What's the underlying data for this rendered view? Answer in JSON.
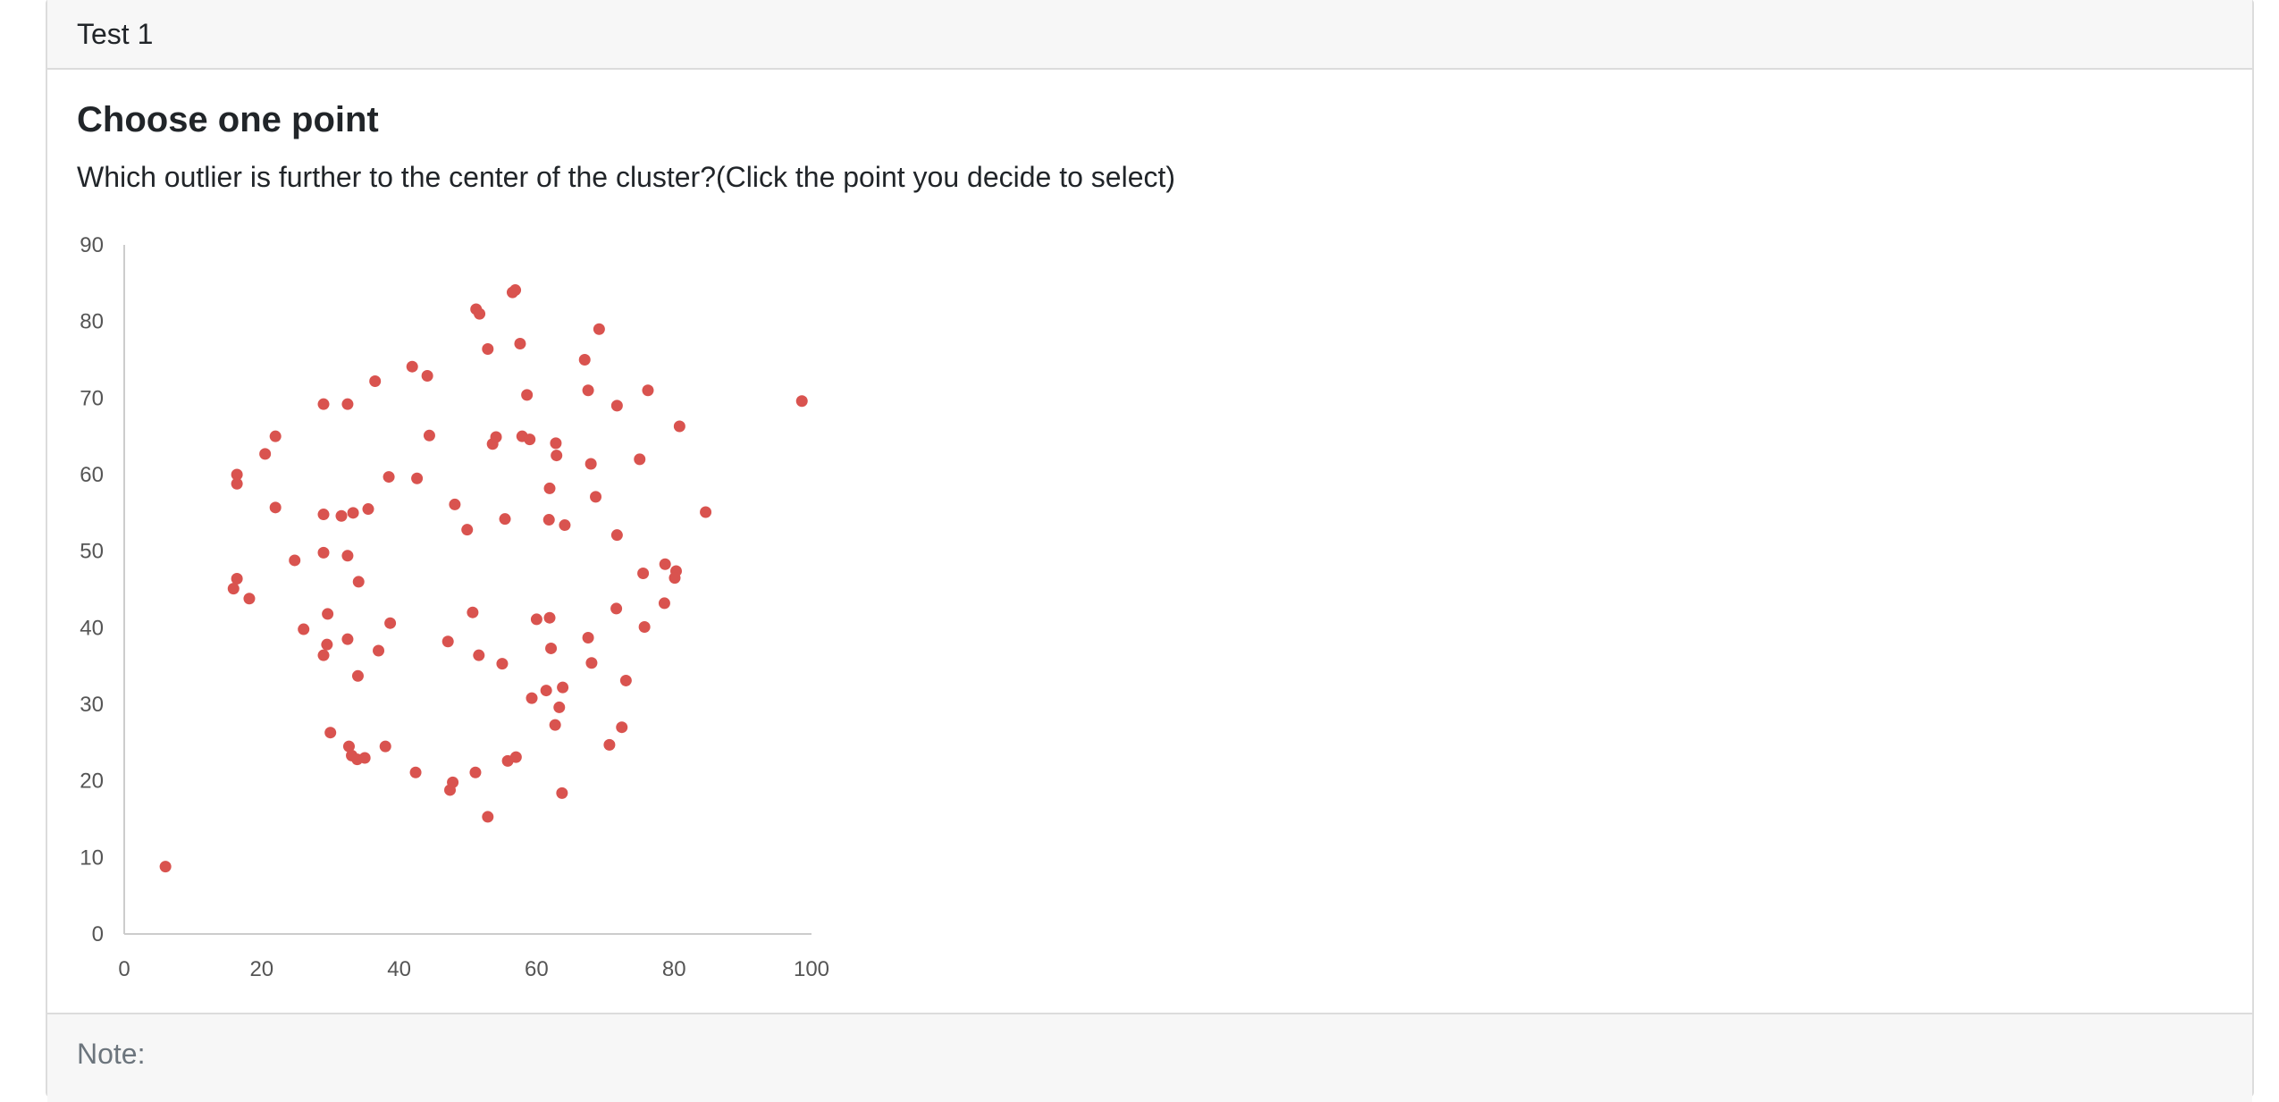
{
  "header": {
    "title": "Test 1"
  },
  "question": {
    "title": "Choose one point",
    "text": "Which outlier is further to the center of the cluster?(Click the point you decide to select)"
  },
  "footer": {
    "note_label": "Note:"
  },
  "colors": {
    "point": "#d9534f",
    "axis": "#cccccc"
  },
  "chart_data": {
    "type": "scatter",
    "title": "",
    "xlabel": "",
    "ylabel": "",
    "xlim": [
      0,
      100
    ],
    "ylim": [
      0,
      90
    ],
    "xticks": [
      0,
      20,
      40,
      60,
      80,
      100
    ],
    "yticks": [
      0,
      10,
      20,
      30,
      40,
      50,
      60,
      70,
      80,
      90
    ],
    "grid": false,
    "legend": "none",
    "points": [
      [
        6.0,
        8.8
      ],
      [
        98.6,
        69.6
      ],
      [
        16.4,
        46.4
      ],
      [
        15.9,
        45.1
      ],
      [
        18.2,
        43.8
      ],
      [
        16.4,
        60.0
      ],
      [
        16.4,
        58.8
      ],
      [
        20.5,
        62.7
      ],
      [
        22.0,
        65.0
      ],
      [
        22.0,
        55.7
      ],
      [
        24.8,
        48.8
      ],
      [
        26.1,
        39.8
      ],
      [
        29.0,
        69.2
      ],
      [
        32.5,
        69.2
      ],
      [
        29.0,
        54.8
      ],
      [
        31.6,
        54.6
      ],
      [
        33.3,
        55.0
      ],
      [
        35.5,
        55.5
      ],
      [
        29.0,
        49.8
      ],
      [
        32.5,
        49.4
      ],
      [
        34.1,
        46.0
      ],
      [
        29.6,
        41.8
      ],
      [
        29.5,
        37.8
      ],
      [
        29.0,
        36.4
      ],
      [
        32.5,
        38.5
      ],
      [
        34.0,
        33.7
      ],
      [
        37.0,
        37.0
      ],
      [
        38.7,
        40.6
      ],
      [
        38.5,
        59.7
      ],
      [
        36.5,
        72.2
      ],
      [
        41.9,
        74.1
      ],
      [
        42.6,
        59.5
      ],
      [
        44.1,
        72.9
      ],
      [
        44.4,
        65.1
      ],
      [
        30.0,
        26.3
      ],
      [
        32.7,
        24.5
      ],
      [
        33.1,
        23.3
      ],
      [
        33.9,
        22.8
      ],
      [
        35.0,
        23.0
      ],
      [
        38.0,
        24.5
      ],
      [
        42.4,
        21.1
      ],
      [
        47.4,
        18.8
      ],
      [
        47.8,
        19.8
      ],
      [
        51.1,
        21.1
      ],
      [
        52.9,
        15.3
      ],
      [
        51.2,
        81.6
      ],
      [
        51.7,
        81.0
      ],
      [
        52.9,
        76.4
      ],
      [
        56.5,
        83.8
      ],
      [
        56.9,
        84.1
      ],
      [
        57.6,
        77.1
      ],
      [
        58.6,
        70.4
      ],
      [
        53.6,
        64.0
      ],
      [
        54.1,
        64.9
      ],
      [
        57.9,
        65.0
      ],
      [
        59.0,
        64.6
      ],
      [
        62.8,
        64.1
      ],
      [
        62.9,
        62.5
      ],
      [
        61.9,
        58.2
      ],
      [
        48.1,
        56.1
      ],
      [
        49.9,
        52.8
      ],
      [
        55.4,
        54.2
      ],
      [
        61.8,
        54.1
      ],
      [
        64.1,
        53.4
      ],
      [
        67.9,
        61.4
      ],
      [
        67.5,
        71.0
      ],
      [
        67.0,
        75.0
      ],
      [
        69.1,
        79.0
      ],
      [
        71.7,
        69.0
      ],
      [
        76.2,
        71.0
      ],
      [
        80.8,
        66.3
      ],
      [
        75.0,
        62.0
      ],
      [
        68.6,
        57.1
      ],
      [
        71.7,
        52.1
      ],
      [
        84.6,
        55.1
      ],
      [
        78.7,
        48.3
      ],
      [
        80.3,
        47.4
      ],
      [
        80.1,
        46.5
      ],
      [
        75.5,
        47.1
      ],
      [
        71.6,
        42.5
      ],
      [
        78.6,
        43.2
      ],
      [
        75.7,
        40.1
      ],
      [
        67.5,
        38.7
      ],
      [
        68.0,
        35.4
      ],
      [
        73.0,
        33.1
      ],
      [
        72.4,
        27.0
      ],
      [
        70.6,
        24.7
      ],
      [
        47.1,
        38.2
      ],
      [
        50.7,
        42.0
      ],
      [
        51.6,
        36.4
      ],
      [
        55.0,
        35.3
      ],
      [
        60.0,
        41.1
      ],
      [
        61.9,
        41.3
      ],
      [
        62.1,
        37.3
      ],
      [
        59.3,
        30.8
      ],
      [
        61.4,
        31.8
      ],
      [
        63.8,
        32.2
      ],
      [
        63.3,
        29.6
      ],
      [
        62.7,
        27.3
      ],
      [
        55.8,
        22.6
      ],
      [
        57.0,
        23.1
      ],
      [
        63.7,
        18.4
      ]
    ]
  }
}
